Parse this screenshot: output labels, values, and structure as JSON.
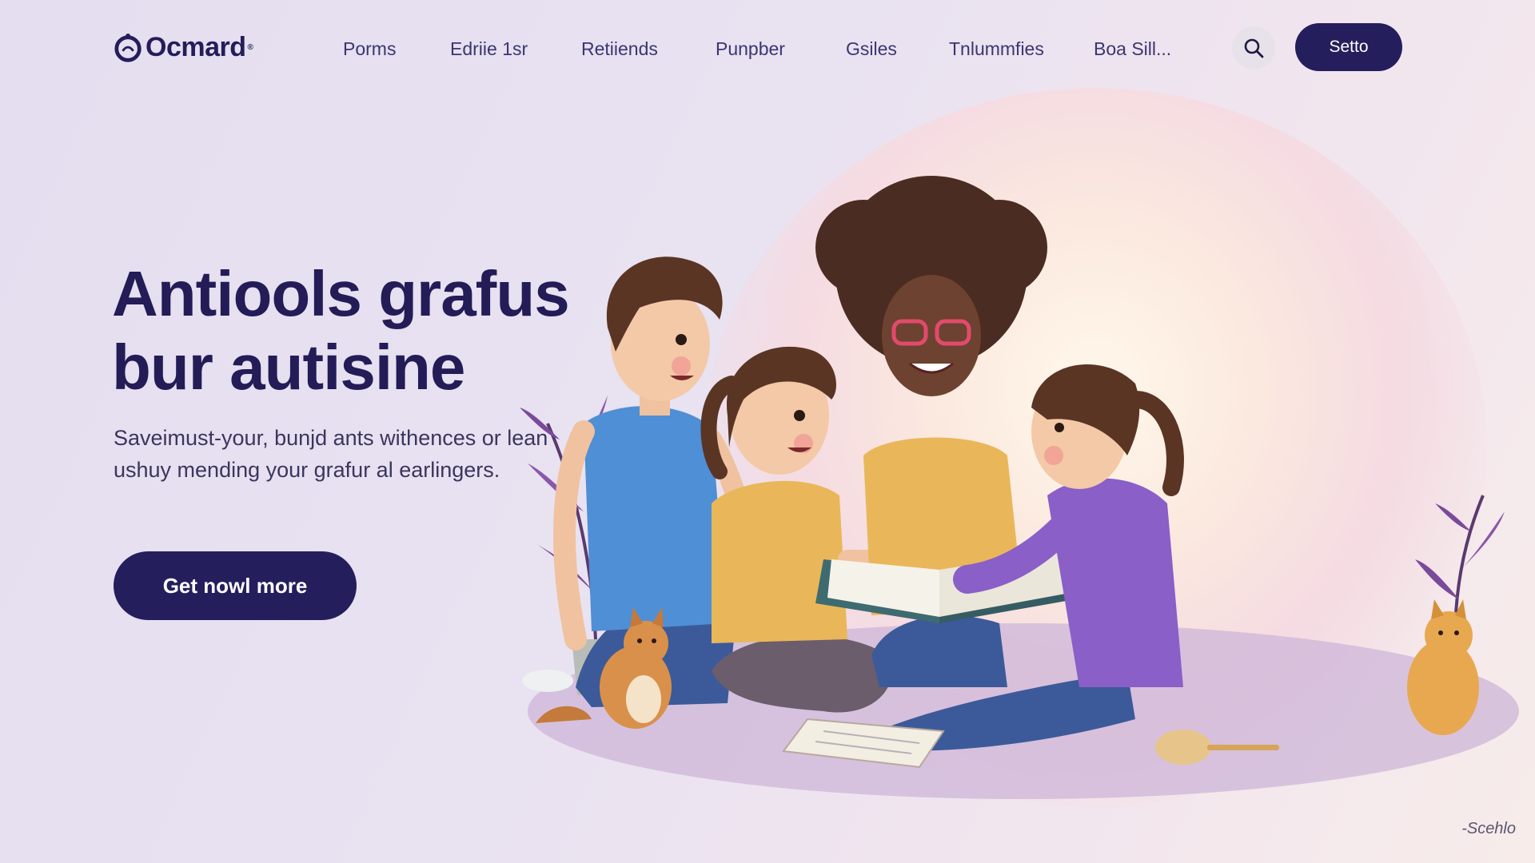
{
  "brand": {
    "name": "Ocmard",
    "trademark": "®"
  },
  "nav": {
    "items": [
      {
        "label": "Porms"
      },
      {
        "label": "Edriie 1sr"
      },
      {
        "label": "Retiiends"
      },
      {
        "label": "Punpber"
      },
      {
        "label": "Gsiles"
      },
      {
        "label": "Tnlummfies"
      },
      {
        "label": "Boa Sill..."
      }
    ],
    "search_icon": "search-icon",
    "cta_label": "Setto"
  },
  "hero": {
    "title_line1": "Antiools grafus",
    "title_line2": "bur autisine",
    "subtitle": "Saveimust-your, bunjd ants withences or lean ushuy mending your grafur al earlingers.",
    "cta_label": "Get nowl more"
  },
  "illustration": {
    "signature": "-Scehlo"
  },
  "colors": {
    "primary": "#251e5d",
    "text": "#231c57",
    "nav_text": "#3b3670",
    "shirt_blue": "#4f8fd6",
    "shirt_yellow": "#e9b75a",
    "shirt_purple": "#8a5fc7",
    "plant_purple": "#7a4a9a"
  }
}
